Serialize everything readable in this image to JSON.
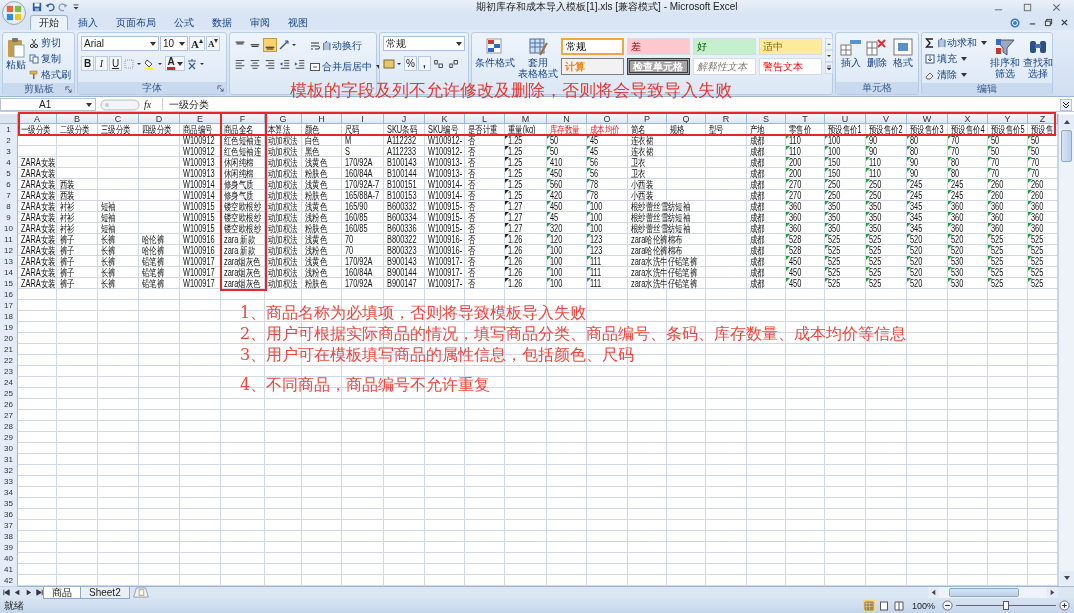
{
  "window": {
    "title": "期初库存和成本导入模板[1].xls  [兼容模式] - Microsoft Excel"
  },
  "tabs": [
    {
      "label": "开始",
      "selected": true
    },
    {
      "label": "插入",
      "selected": false
    },
    {
      "label": "页面布局",
      "selected": false
    },
    {
      "label": "公式",
      "selected": false
    },
    {
      "label": "数据",
      "selected": false
    },
    {
      "label": "审阅",
      "selected": false
    },
    {
      "label": "视图",
      "selected": false
    }
  ],
  "ribbon": {
    "clipboard": {
      "paste": "粘贴",
      "cut": "剪切",
      "copy": "复制",
      "format_painter": "格式刷",
      "label": "剪贴板"
    },
    "font": {
      "name": "Arial",
      "size": "10",
      "grow": "A",
      "shrink": "A",
      "bold": "B",
      "italic": "I",
      "underline": "U",
      "font_color": "A",
      "label": "字体"
    },
    "alignment": {
      "vertical_align": [
        {
          "selected": false
        },
        {
          "selected": false
        },
        {
          "selected": true
        }
      ],
      "wrap": "自动换行",
      "merge": "合并后居中"
    },
    "number": {
      "format": "常规",
      "percent": "%",
      "comma": ","
    },
    "styles": {
      "conditional": "条件格式",
      "table_format": [
        "套用",
        "表格格式"
      ],
      "gallery": [
        {
          "text": "常规",
          "kind": "normal",
          "selected": true
        },
        {
          "text": "差",
          "kind": "bad",
          "selected": false
        },
        {
          "text": "好",
          "kind": "good",
          "selected": false
        },
        {
          "text": "适中",
          "kind": "neutral",
          "selected": false
        },
        {
          "text": "计算",
          "kind": "calculation",
          "selected": false
        },
        {
          "text": "检查单元格",
          "kind": "check",
          "selected": false
        },
        {
          "text": "解释性文本",
          "kind": "explanatory",
          "selected": false
        },
        {
          "text": "警告文本",
          "kind": "warning",
          "selected": false
        }
      ]
    },
    "cells": {
      "insert": "插入",
      "delete": "删除",
      "format": "格式",
      "label": "单元格"
    },
    "editing": {
      "autosum": "自动求和",
      "fill": "填充",
      "clear": "清除",
      "sort": [
        "排序和",
        "筛选"
      ],
      "find": [
        "查找和",
        "选择"
      ],
      "label": "编辑"
    }
  },
  "banner": "模板的字段及列不允许修改及删除，否则将会导致导入失败",
  "formula_bar": {
    "name_box": "A1",
    "function_label": "fx",
    "value": "一级分类"
  },
  "sheet": {
    "columns": [
      {
        "letter": "A"
      },
      {
        "letter": "B"
      },
      {
        "letter": "C"
      },
      {
        "letter": "D"
      },
      {
        "letter": "E"
      },
      {
        "letter": "F"
      },
      {
        "letter": "G"
      },
      {
        "letter": "H"
      },
      {
        "letter": "I"
      },
      {
        "letter": "J"
      },
      {
        "letter": "K"
      },
      {
        "letter": "L"
      },
      {
        "letter": "M",
        "marker": {
          "color": "#222222"
        }
      },
      {
        "letter": "N",
        "marker": {
          "color": "#1e9e3a"
        }
      },
      {
        "letter": "O",
        "marker": {
          "color": "#1e9e3a"
        }
      },
      {
        "letter": "P"
      },
      {
        "letter": "Q"
      },
      {
        "letter": "R"
      },
      {
        "letter": "S"
      },
      {
        "letter": "T",
        "marker": {
          "color": "#1e9e3a"
        }
      },
      {
        "letter": "U",
        "marker": {
          "color": "#1e9e3a"
        }
      },
      {
        "letter": "V",
        "marker": {
          "color": "#1e9e3a"
        }
      },
      {
        "letter": "W",
        "marker": {
          "color": "#1e9e3a"
        }
      },
      {
        "letter": "X",
        "marker": {
          "color": "#1e9e3a"
        }
      },
      {
        "letter": "Y",
        "marker": {
          "color": "#1e9e3a"
        }
      },
      {
        "letter": "Z",
        "marker": {
          "color": "#1e9e3a"
        }
      }
    ],
    "header": [
      {
        "text": "一级分类",
        "required": false
      },
      {
        "text": "二级分类",
        "required": false
      },
      {
        "text": "三级分类",
        "required": false
      },
      {
        "text": "四级分类",
        "required": false
      },
      {
        "text": "商品编号",
        "required": false
      },
      {
        "text": "商品全名",
        "required": false
      },
      {
        "text": "本算法",
        "required": false
      },
      {
        "text": "颜色",
        "required": false
      },
      {
        "text": "尺码",
        "required": false
      },
      {
        "text": "SKU条码",
        "required": false
      },
      {
        "text": "SKU编号",
        "required": false
      },
      {
        "text": "是否计重",
        "required": false
      },
      {
        "text": "重量(kg)",
        "required": false
      },
      {
        "text": "库存数量",
        "required": true
      },
      {
        "text": "成本均价",
        "required": true
      },
      {
        "text": "简名",
        "required": false
      },
      {
        "text": "规格",
        "required": false
      },
      {
        "text": "型号",
        "required": false
      },
      {
        "text": "产地",
        "required": false
      },
      {
        "text": "零售价",
        "required": false
      },
      {
        "text": "预设售价1",
        "required": false
      },
      {
        "text": "预设售价2",
        "required": false
      },
      {
        "text": "预设售价3",
        "required": false
      },
      {
        "text": "预设售价4",
        "required": false
      },
      {
        "text": "预设售价5",
        "required": false
      },
      {
        "text": "预设售",
        "required": false
      }
    ],
    "rows": [
      [
        null,
        null,
        null,
        null,
        "W100912",
        "红色短袖连",
        "动加权法",
        "白色",
        "M",
        "A112232",
        "W100912-",
        "否",
        "1.25",
        "50",
        "45",
        "连衣裙",
        null,
        null,
        "成都",
        "110",
        "100",
        "90",
        "80",
        "70",
        "50",
        "50"
      ],
      [
        null,
        null,
        null,
        null,
        "W100912",
        "红色短袖连",
        "动加权法",
        "黑色",
        "S",
        "A112233",
        "W100912-",
        "否",
        "1.25",
        "50",
        "45",
        "连衣裙",
        null,
        null,
        "成都",
        "110",
        "100",
        "90",
        "80",
        "70",
        "50",
        "50"
      ],
      [
        "ZARA女装",
        null,
        null,
        null,
        "W100913",
        "休闲纯棉",
        "动加权法",
        "浅黄色",
        "170/92A",
        "B100143",
        "W100913-",
        "否",
        "1.25",
        "410",
        "56",
        "卫衣",
        null,
        null,
        "成都",
        "200",
        "150",
        "110",
        "90",
        "80",
        "70",
        "70"
      ],
      [
        "ZARA女装",
        null,
        null,
        null,
        "W100913",
        "休闲纯棉",
        "动加权法",
        "粉肤色",
        "160/84A",
        "B100144",
        "W100913-",
        "否",
        "1.25",
        "450",
        "56",
        "卫衣",
        null,
        null,
        "成都",
        "200",
        "150",
        "110",
        "90",
        "80",
        "70",
        "70"
      ],
      [
        "ZARA女装",
        "西装",
        null,
        null,
        "W100914",
        "修身气质",
        "动加权法",
        "浅黄色",
        "170/92A-7",
        "B100151",
        "W100914-",
        "否",
        "1.25",
        "560",
        "78",
        "小西装",
        null,
        null,
        "成都",
        "270",
        "250",
        "250",
        "245",
        "245",
        "260",
        "260"
      ],
      [
        "ZARA女装",
        "西装",
        null,
        null,
        "W100914",
        "修身气质",
        "动加权法",
        "粉肤色",
        "165/88A-7",
        "B100153",
        "W100914-",
        "否",
        "1.25",
        "420",
        "78",
        "小西装",
        null,
        null,
        "成都",
        "270",
        "250",
        "250",
        "245",
        "245",
        "260",
        "260"
      ],
      [
        "ZARA女装",
        "衬衫",
        "短袖",
        null,
        "W100915",
        "镂空欧根纱",
        "动加权法",
        "浅黄色",
        "165/90",
        "B600332",
        "W100915-",
        "否",
        "1.27",
        "450",
        "100",
        "根纱蕾丝雪纺短袖",
        null,
        null,
        "成都",
        "360",
        "350",
        "350",
        "345",
        "360",
        "360",
        "360"
      ],
      [
        "ZARA女装",
        "衬衫",
        "短袖",
        null,
        "W100915",
        "镂空欧根纱",
        "动加权法",
        "浅粉色",
        "160/85",
        "B600334",
        "W100915-",
        "否",
        "1.27",
        "45",
        "100",
        "根纱蕾丝雪纺短袖",
        null,
        null,
        "成都",
        "360",
        "350",
        "350",
        "345",
        "360",
        "360",
        "360"
      ],
      [
        "ZARA女装",
        "衬衫",
        "短袖",
        null,
        "W100915",
        "镂空欧根纱",
        "动加权法",
        "粉肤色",
        "160/85",
        "B600336",
        "W100915-",
        "否",
        "1.27",
        "320",
        "100",
        "根纱蕾丝雪纺短袖",
        null,
        null,
        "成都",
        "360",
        "350",
        "350",
        "345",
        "360",
        "360",
        "360"
      ],
      [
        "ZARA女装",
        "裤子",
        "长裤",
        "哈伦裤",
        "W100916",
        "zara 新款",
        "动加权法",
        "浅黄色",
        "70",
        "B800322",
        "W100916-",
        "否",
        "1.26",
        "120",
        "123",
        "zara哈伦裤棉布",
        null,
        null,
        "成都",
        "528",
        "525",
        "525",
        "520",
        "520",
        "525",
        "525"
      ],
      [
        "ZARA女装",
        "裤子",
        "长裤",
        "哈伦裤",
        "W100916",
        "zara 新款",
        "动加权法",
        "浅粉色",
        "70",
        "B800323",
        "W100916-",
        "否",
        "1.26",
        "100",
        "123",
        "zara哈伦裤棉布",
        null,
        null,
        "成都",
        "528",
        "525",
        "525",
        "520",
        "520",
        "525",
        "525"
      ],
      [
        "ZARA女装",
        "裤子",
        "长裤",
        "铅笔裤",
        "W100917",
        "zara烟灰色",
        "动加权法",
        "浅黄色",
        "170/92A",
        "B900143",
        "W100917-",
        "否",
        "1.26",
        "100",
        "111",
        "zara水洗牛仔铅笔裤",
        null,
        null,
        "成都",
        "450",
        "525",
        "525",
        "520",
        "530",
        "525",
        "525"
      ],
      [
        "ZARA女装",
        "裤子",
        "长裤",
        "铅笔裤",
        "W100917",
        "zara烟灰色",
        "动加权法",
        "浅粉色",
        "160/84A",
        "B900144",
        "W100917-",
        "否",
        "1.26",
        "100",
        "111",
        "zara水洗牛仔铅笔裤",
        null,
        null,
        "成都",
        "450",
        "525",
        "525",
        "520",
        "530",
        "525",
        "525"
      ],
      [
        "ZARA女装",
        "裤子",
        "长裤",
        "铅笔裤",
        "W100917",
        "zara烟灰色",
        "动加权法",
        "粉肤色",
        "170/92A",
        "B900147",
        "W100917-",
        "否",
        "1.26",
        "100",
        "111",
        "zara水洗牛仔铅笔裤",
        null,
        null,
        "成都",
        "450",
        "525",
        "525",
        "520",
        "530",
        "525",
        "525"
      ]
    ],
    "row_numbers": [
      "1",
      "2",
      "3",
      "4",
      "5",
      "6",
      "7",
      "8",
      "9",
      "10",
      "11",
      "12",
      "13",
      "14",
      "15",
      "16",
      "17",
      "18",
      "19",
      "20",
      "21",
      "22",
      "23",
      "24",
      "25",
      "26",
      "27",
      "28",
      "29",
      "30",
      "31",
      "32",
      "33",
      "34",
      "35",
      "36",
      "37",
      "38",
      "39",
      "40",
      "41",
      "42"
    ]
  },
  "notes": [
    "1、商品名称为必填项，否则将导致模板导入失败",
    "2、用户可根据实际商品的情况，填写商品分类、商品编号、条码、库存数量、成本均价等信息",
    "3、用户可在模板填写商品的属性信息，包括颜色、尺码",
    "4、不同商品，商品编号不允许重复"
  ],
  "sheet_tabs": [
    {
      "label": "商品",
      "selected": true
    },
    {
      "label": "Sheet2",
      "selected": false
    }
  ],
  "status_bar": {
    "status": "就绪",
    "views": [
      {
        "selected": true
      },
      {
        "selected": false
      },
      {
        "selected": false
      }
    ],
    "zoom": "100%",
    "zoom_slider": {
      "level": 0.5
    }
  }
}
